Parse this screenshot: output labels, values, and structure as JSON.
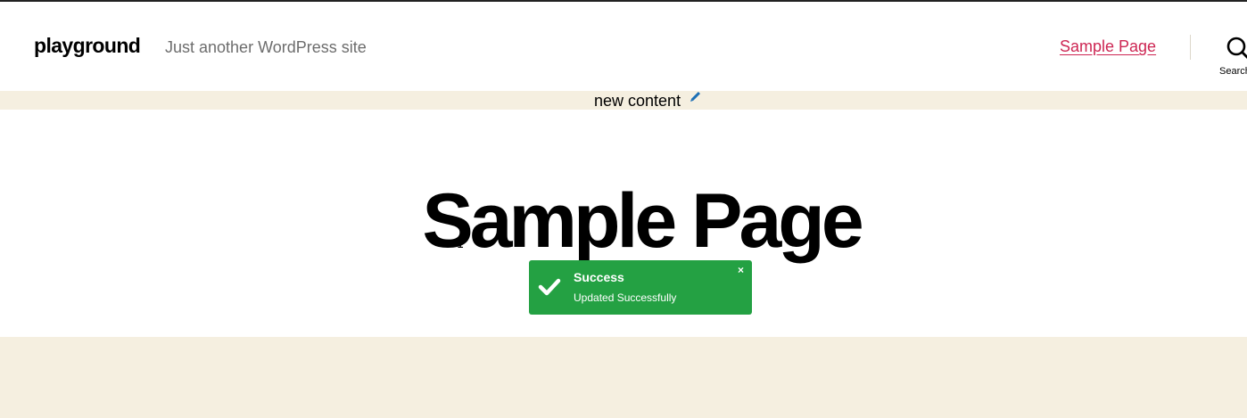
{
  "header": {
    "site_title": "playground",
    "tagline": "Just another WordPress site",
    "nav": [
      {
        "label": "Sample Page"
      }
    ],
    "search_label": "Search"
  },
  "strip": {
    "text": "new content",
    "edit_icon": "pencil-icon"
  },
  "main": {
    "page_title": "Sample Page"
  },
  "toast": {
    "title": "Success",
    "message": "Updated Successfully",
    "close_glyph": "×",
    "icon": "check-icon"
  },
  "colors": {
    "accent": "#cd2653",
    "band": "#f5efe0",
    "toast_success": "#24a143",
    "tagline": "#6d6d6d"
  }
}
